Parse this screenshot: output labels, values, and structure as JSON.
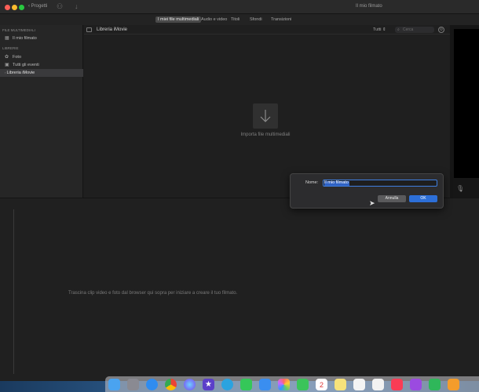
{
  "titlebar": {
    "projects_label": "‹ Progetti",
    "title": "Il mio filmato"
  },
  "tabs": [
    {
      "label": "I miei file multimediali",
      "active": true
    },
    {
      "label": "Audio e video",
      "active": false
    },
    {
      "label": "Titoli",
      "active": false
    },
    {
      "label": "Sfondi",
      "active": false
    },
    {
      "label": "Transizioni",
      "active": false
    }
  ],
  "sidebar": {
    "section_media": "FILE MULTIMEDIALI",
    "project_item": "Il mio filmato",
    "section_libraries": "LIBRERIE",
    "items": [
      {
        "label": "Foto",
        "icon": "photos-icon"
      },
      {
        "label": "Tutti gli eventi",
        "icon": "events-icon"
      },
      {
        "label": "Libreria iMovie",
        "icon": "library-icon"
      }
    ]
  },
  "browser": {
    "library_title": "Libreria iMovie",
    "filter_label": "Tutti ⇕",
    "search_placeholder": "Cerca",
    "import_label": "Importa file multimediali"
  },
  "timeline": {
    "hint": "Trascina clip video e foto dal browser qui sopra per iniziare a creare il tuo filmato."
  },
  "dialog": {
    "name_label": "Nome:",
    "name_value": "Il mio filmato",
    "cancel_label": "Annulla",
    "ok_label": "OK"
  },
  "colors": {
    "accent": "#2d6fd8",
    "background": "#1e1e1e"
  },
  "dock": {
    "icons": [
      "finder-icon",
      "launchpad-icon",
      "safari-icon",
      "chrome-icon",
      "siri-icon",
      "imovie-icon",
      "telegram-icon",
      "messages-icon",
      "mail-icon",
      "photos-icon",
      "facetime-icon",
      "calendar-icon",
      "notes-icon",
      "reminders-icon",
      "music-icon",
      "podcasts-icon",
      "numbers-icon",
      "pages-icon"
    ],
    "calendar_day": "2"
  }
}
